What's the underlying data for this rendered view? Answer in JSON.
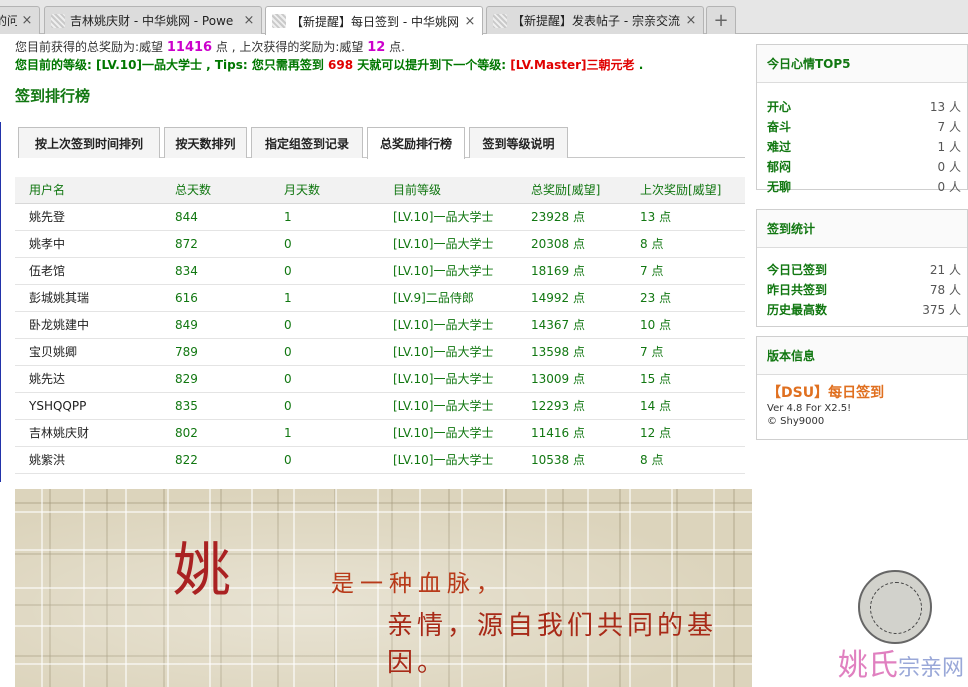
{
  "tabs": [
    {
      "title": "的问",
      "active": false
    },
    {
      "title": "吉林姚庆财 - 中华姚网 - Powe",
      "active": false
    },
    {
      "title": "【新提醒】每日签到 - 中华姚网",
      "active": true
    },
    {
      "title": "【新提醒】发表帖子 - 宗亲交流",
      "active": false
    }
  ],
  "newtab_label": "+",
  "close_glyph": "×",
  "info": {
    "line1": {
      "p1": "您目前获得的总奖励为:威望 ",
      "total": "11416",
      "p2": " 点 , 上次获得的奖励为:威望 ",
      "last": "12",
      "p3": " 点."
    },
    "line2": {
      "p1": "您目前的等级: [LV.10]一品大学士 , Tips: 您只需再签到 ",
      "days": "698",
      "p2": " 天就可以提升到下一个等级: ",
      "next": "[LV.Master]三朝元老",
      "p3": " ."
    }
  },
  "rank_title": "签到排行榜",
  "rank_tabs": [
    {
      "label": "按上次签到时间排列",
      "active": false
    },
    {
      "label": "按天数排列",
      "active": false
    },
    {
      "label": "指定组签到记录",
      "active": false
    },
    {
      "label": "总奖励排行榜",
      "active": true
    },
    {
      "label": "签到等级说明",
      "active": false
    }
  ],
  "table": {
    "headers": [
      "用户名",
      "总天数",
      "月天数",
      "目前等级",
      "总奖励[威望]",
      "上次奖励[威望]"
    ],
    "rows": [
      [
        "姚先登",
        "844",
        "1",
        "[LV.10]一品大学士",
        "23928 点",
        "13 点"
      ],
      [
        "姚孝中",
        "872",
        "0",
        "[LV.10]一品大学士",
        "20308 点",
        "8 点"
      ],
      [
        "伍老馆",
        "834",
        "0",
        "[LV.10]一品大学士",
        "18169 点",
        "7 点"
      ],
      [
        "彭城姚其瑞",
        "616",
        "1",
        "[LV.9]二品侍郎",
        "14992 点",
        "23 点"
      ],
      [
        "卧龙姚建中",
        "849",
        "0",
        "[LV.10]一品大学士",
        "14367 点",
        "10 点"
      ],
      [
        "宝贝姚卿",
        "789",
        "0",
        "[LV.10]一品大学士",
        "13598 点",
        "7 点"
      ],
      [
        "姚先达",
        "829",
        "0",
        "[LV.10]一品大学士",
        "13009 点",
        "15 点"
      ],
      [
        "YSHQQPP",
        "835",
        "0",
        "[LV.10]一品大学士",
        "12293 点",
        "14 点"
      ],
      [
        "吉林姚庆财",
        "802",
        "1",
        "[LV.10]一品大学士",
        "11416 点",
        "12 点"
      ],
      [
        "姚紫洪",
        "822",
        "0",
        "[LV.10]一品大学士",
        "10538 点",
        "8 点"
      ]
    ]
  },
  "banner": {
    "big_char": "姚",
    "line1": "是一种血脉，",
    "line2": "亲情，源自我们共同的基因。",
    "watermark_a": "姚氏",
    "watermark_b": "宗亲网"
  },
  "sidebar": {
    "mood": {
      "title": "今日心情TOP5",
      "items": [
        {
          "label": "开心",
          "value": "13 人"
        },
        {
          "label": "奋斗",
          "value": "7 人"
        },
        {
          "label": "难过",
          "value": "1 人"
        },
        {
          "label": "郁闷",
          "value": "0 人"
        },
        {
          "label": "无聊",
          "value": "0 人"
        }
      ]
    },
    "stats": {
      "title": "签到统计",
      "items": [
        {
          "label": "今日已签到",
          "value": "21 人"
        },
        {
          "label": "昨日共签到",
          "value": "78 人"
        },
        {
          "label": "历史最高数",
          "value": "375 人"
        }
      ]
    },
    "version": {
      "title": "版本信息",
      "dsu": "【DSU】每日签到",
      "ver": "Ver 4.8 For X2.5!",
      "copyright": "© Shy9000"
    }
  }
}
